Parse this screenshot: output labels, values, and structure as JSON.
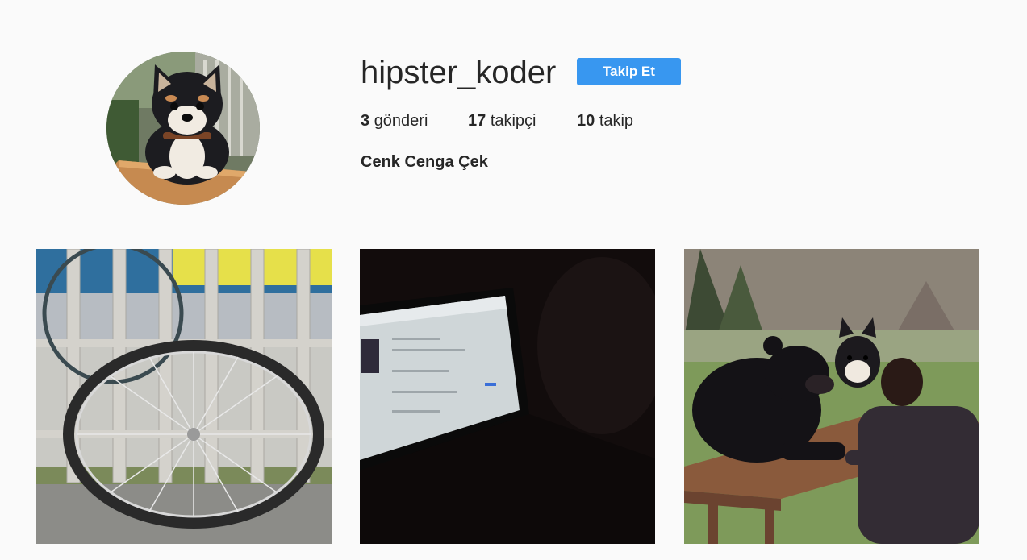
{
  "profile": {
    "username": "hipster_koder",
    "follow_label": "Takip Et",
    "full_name": "Cenk Cenga Çek",
    "stats": {
      "posts_count": "3",
      "posts_label": "gönderi",
      "followers_count": "17",
      "followers_label": "takipçi",
      "following_count": "10",
      "following_label": "takip"
    }
  },
  "colors": {
    "page_background": "#fafafa",
    "text": "#262626",
    "follow_button": "#3897f0",
    "follow_button_text": "#ffffff"
  },
  "posts": [
    {
      "subject": "bicycle-wheel-photo"
    },
    {
      "subject": "laptop-in-dark-photo"
    },
    {
      "subject": "bear-dog-man-picnic-photo"
    }
  ]
}
